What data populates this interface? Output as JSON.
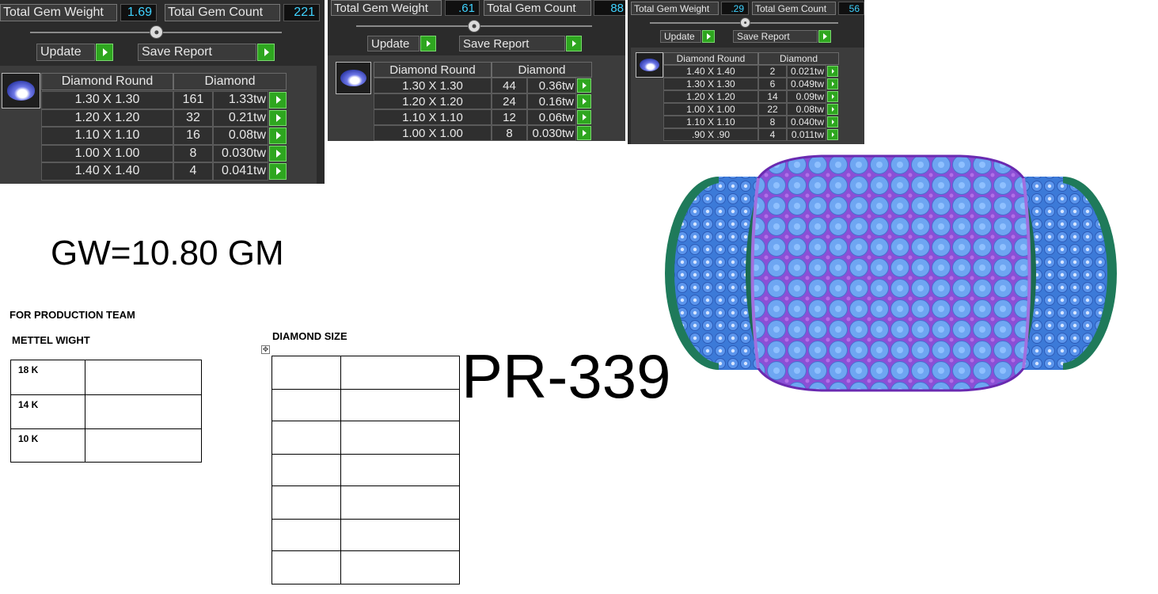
{
  "panels": [
    {
      "total_gem_weight_label": "Total Gem Weight",
      "total_gem_weight": "1.69",
      "total_gem_count_label": "Total Gem Count",
      "total_gem_count": "221",
      "update_label": "Update",
      "save_report_label": "Save Report",
      "col_shape": "Diamond Round",
      "col_diamond": "Diamond",
      "rows": [
        {
          "size": "1.30 X 1.30",
          "count": "161",
          "weight": "1.33tw"
        },
        {
          "size": "1.20 X 1.20",
          "count": "32",
          "weight": "0.21tw"
        },
        {
          "size": "1.10 X 1.10",
          "count": "16",
          "weight": "0.08tw"
        },
        {
          "size": "1.00 X 1.00",
          "count": "8",
          "weight": "0.030tw"
        },
        {
          "size": "1.40 X 1.40",
          "count": "4",
          "weight": "0.041tw"
        }
      ]
    },
    {
      "total_gem_weight_label": "Total Gem Weight",
      "total_gem_weight": ".61",
      "total_gem_count_label": "Total Gem Count",
      "total_gem_count": "88",
      "update_label": "Update",
      "save_report_label": "Save Report",
      "col_shape": "Diamond Round",
      "col_diamond": "Diamond",
      "rows": [
        {
          "size": "1.30 X 1.30",
          "count": "44",
          "weight": "0.36tw"
        },
        {
          "size": "1.20 X 1.20",
          "count": "24",
          "weight": "0.16tw"
        },
        {
          "size": "1.10 X 1.10",
          "count": "12",
          "weight": "0.06tw"
        },
        {
          "size": "1.00 X 1.00",
          "count": "8",
          "weight": "0.030tw"
        }
      ]
    },
    {
      "total_gem_weight_label": "Total Gem Weight",
      "total_gem_weight": ".29",
      "total_gem_count_label": "Total Gem Count",
      "total_gem_count": "56",
      "update_label": "Update",
      "save_report_label": "Save Report",
      "col_shape": "Diamond Round",
      "col_diamond": "Diamond",
      "rows": [
        {
          "size": "1.40 X 1.40",
          "count": "2",
          "weight": "0.021tw"
        },
        {
          "size": "1.30 X 1.30",
          "count": "6",
          "weight": "0.049tw"
        },
        {
          "size": "1.20 X 1.20",
          "count": "14",
          "weight": "0.09tw"
        },
        {
          "size": "1.00 X 1.00",
          "count": "22",
          "weight": "0.08tw"
        },
        {
          "size": "1.10 X 1.10",
          "count": "8",
          "weight": "0.040tw"
        },
        {
          "size": ".90 X .90",
          "count": "4",
          "weight": "0.011tw"
        }
      ]
    }
  ],
  "sheet": {
    "gross_weight": "GW=10.80 GM",
    "design_code": "PR-339",
    "production_team_label": "FOR PRODUCTION TEAM",
    "metal_weight_label": "METTEL WIGHT",
    "metal_rows": [
      "18 K",
      "14 K",
      "10 K"
    ],
    "diamond_size_label": "DIAMOND SIZE",
    "diamond_size_rows": 7
  },
  "colors": {
    "panel_bg": "#2b2b2b",
    "value_text": "#3fd2ff",
    "go_button": "#2ea61f",
    "ring_gem_blue": "#5b9cf0",
    "ring_prong_purple": "#8a2fc8",
    "ring_metal_green": "#1f7a5a"
  },
  "icons": [
    "gem-round-icon",
    "play-arrow-icon",
    "move-handle-icon"
  ]
}
